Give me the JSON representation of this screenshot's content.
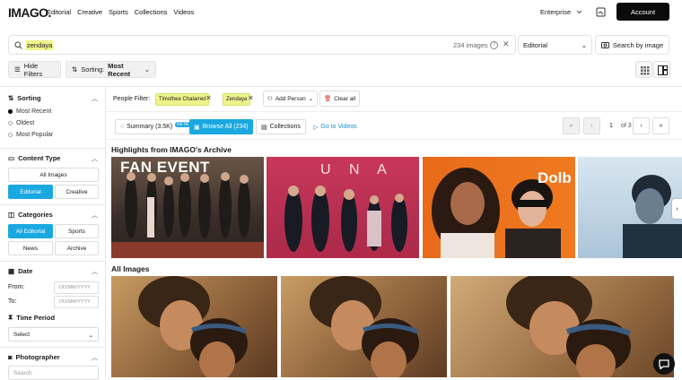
{
  "header": {
    "logo": "IMAGO.",
    "nav": [
      "Editorial",
      "Creative",
      "Sports",
      "Collections",
      "Videos"
    ],
    "environment": "Enterprise",
    "account_label": "Account"
  },
  "search": {
    "query": "zendaya",
    "count": "234 images",
    "help": "?",
    "type_value": "Editorial",
    "search_by_image": "Search by image"
  },
  "toolbar": {
    "hide_filters": "Hide Filters",
    "sorting_prefix": "Sorting:",
    "sorting_value": "Most Recent"
  },
  "sidebar": {
    "sorting": {
      "title": "Sorting",
      "options": [
        {
          "label": "Most Recent",
          "selected": true
        },
        {
          "label": "Oldest",
          "selected": false
        },
        {
          "label": "Most Popular",
          "selected": false
        }
      ]
    },
    "content_type": {
      "title": "Content Type",
      "all": "All Images",
      "editorial": "Editorial",
      "creative": "Creative"
    },
    "categories": {
      "title": "Categories",
      "all_editorial": "All Editorial",
      "sports": "Sports",
      "news": "News",
      "archive": "Archive"
    },
    "date": {
      "title": "Date",
      "from_label": "From:",
      "to_label": "To:",
      "placeholder": "DD/MM/YYYY"
    },
    "time_period": {
      "title": "Time Period",
      "select": "Select"
    },
    "photographer": {
      "title": "Photographer",
      "search": "Search"
    }
  },
  "people_filter": {
    "label": "People Filter:",
    "chips": [
      "Timothee Chalamet",
      "Zendaya"
    ],
    "add_person": "Add Person",
    "clear_all": "Clear all"
  },
  "tabs": {
    "summary": "Summary (3.5K)",
    "beta": "BETA",
    "browse_all": "Browse All (234)",
    "collections": "Collections",
    "videos": "Go to Videos"
  },
  "pagination": {
    "current": "1",
    "total": "of 3"
  },
  "highlights_title": "Highlights from IMAGO's Archive",
  "highlight_images": [
    {
      "caption": "FAN EVENT"
    },
    {
      "caption": "U N A"
    },
    {
      "caption": "Dolb"
    },
    {
      "caption": ""
    }
  ],
  "all_images_title": "All Images",
  "colors": {
    "accent": "#1aa8e0",
    "highlight": "#eef48a",
    "account_bg": "#0b0b0b"
  }
}
